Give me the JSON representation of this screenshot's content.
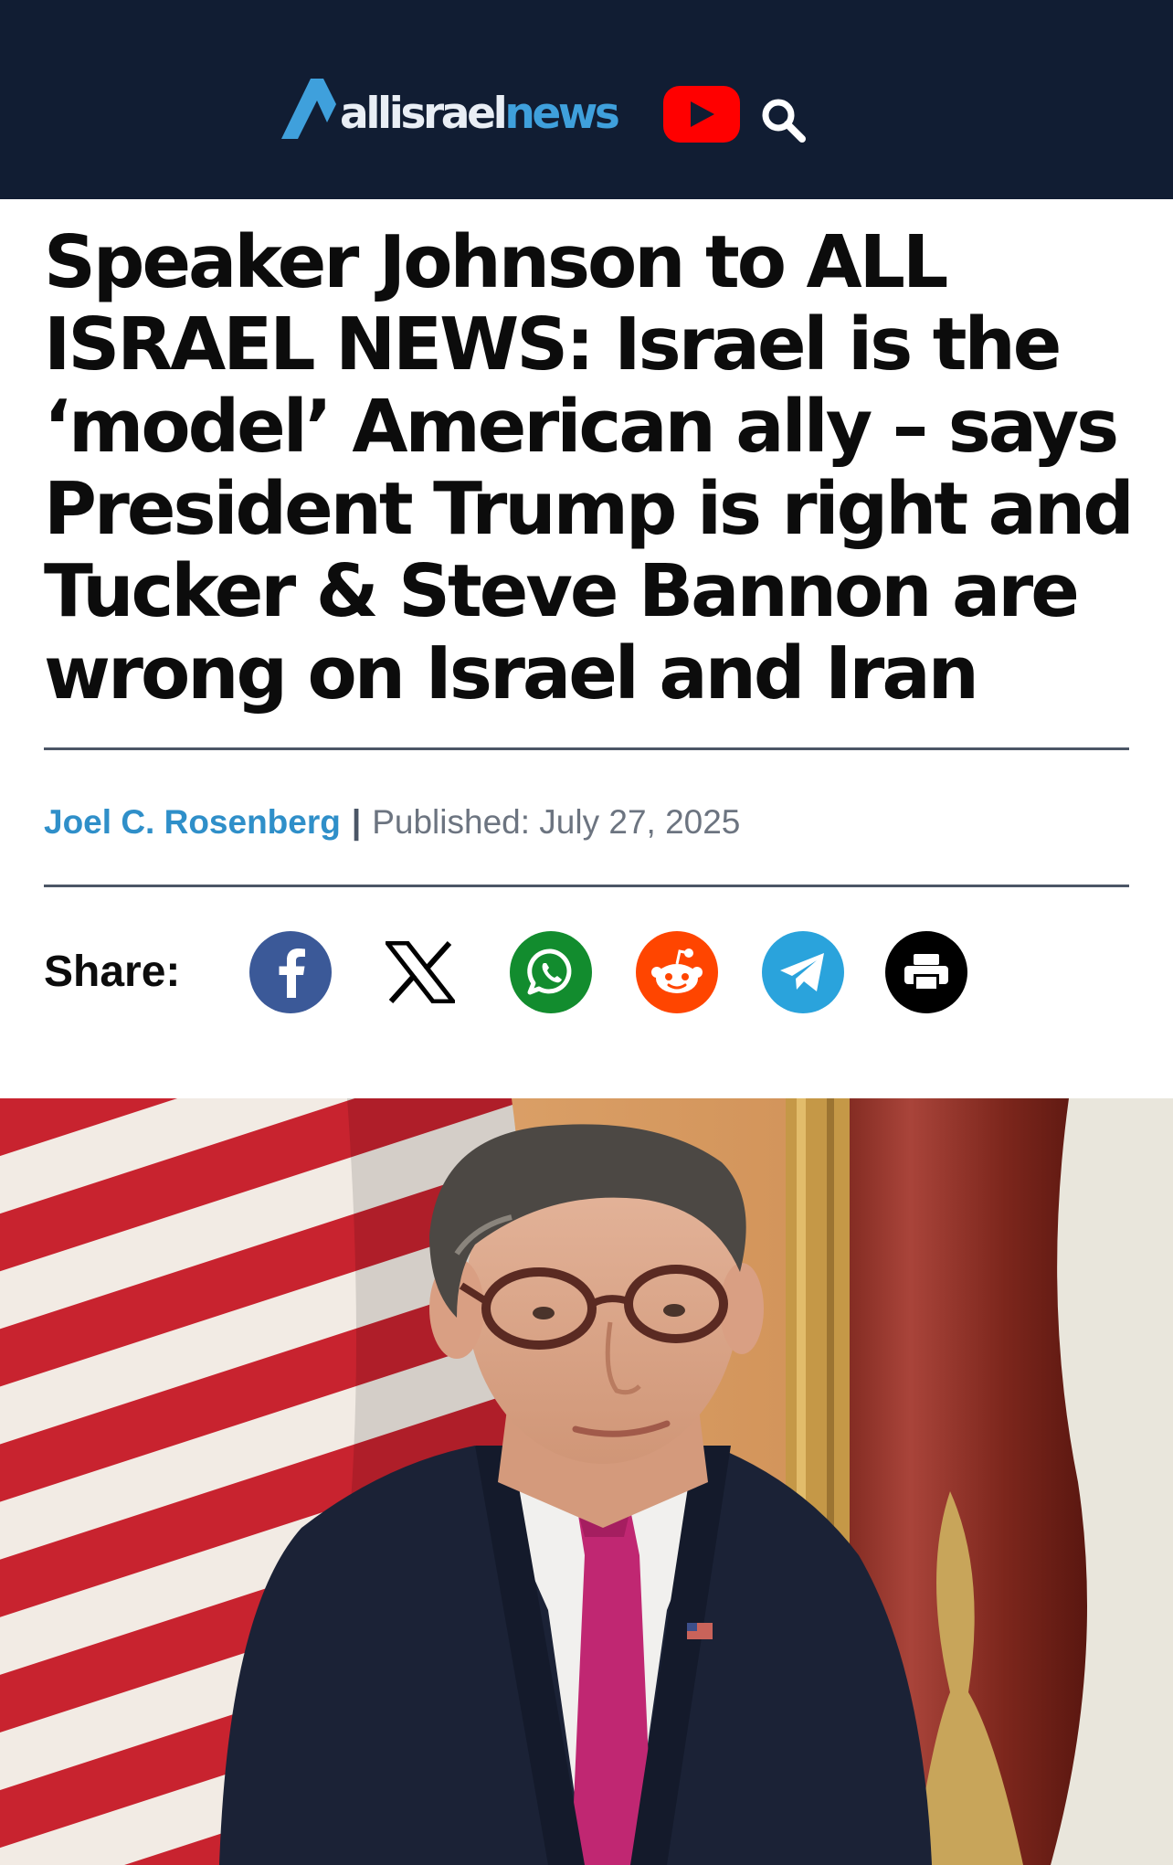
{
  "header": {
    "logo_part1": "allisrael",
    "logo_part2": "news"
  },
  "article": {
    "headline": "Speaker Johnson to ALL ISRAEL NEWS: Israel is the ‘model’ American ally – says President Trump is right and Tucker & Steve Bannon are wrong on Israel and Iran",
    "author": "Joel C. Rosenberg",
    "separator": "|",
    "published": "Published: July 27, 2025"
  },
  "share": {
    "label": "Share:",
    "buttons": [
      {
        "icon": "facebook-icon",
        "color": "#3b5998"
      },
      {
        "icon": "x-icon",
        "color": "#000000"
      },
      {
        "icon": "whatsapp-icon",
        "color": "#128c2e"
      },
      {
        "icon": "reddit-icon",
        "color": "#ff4500"
      },
      {
        "icon": "telegram-icon",
        "color": "#2aa3dc"
      },
      {
        "icon": "print-icon",
        "color": "#000000"
      }
    ]
  },
  "colors": {
    "header_bg": "#111d33",
    "brand_blue": "#3fa0dc",
    "author_blue": "#2f8fc9"
  }
}
